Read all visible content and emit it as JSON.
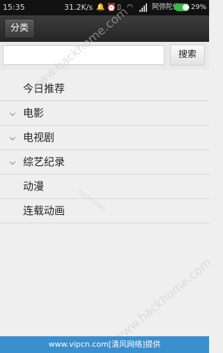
{
  "status_bar": {
    "time": "15:35",
    "net_speed": "31.2K/s",
    "carrier": "阿弥陀佛",
    "battery": "29%",
    "icons": [
      "bell-icon",
      "alarm-icon",
      "vibrate-icon",
      "wifi-icon",
      "signal-icon",
      "toggle-icon"
    ]
  },
  "toolbar": {
    "category_label": "分类"
  },
  "search": {
    "value": "",
    "button_label": "搜索"
  },
  "menu": {
    "items": [
      {
        "label": "今日推荐",
        "expandable": false
      },
      {
        "label": "电影",
        "expandable": true
      },
      {
        "label": "电视剧",
        "expandable": true
      },
      {
        "label": "综艺纪录",
        "expandable": true
      },
      {
        "label": "动漫",
        "expandable": false
      },
      {
        "label": "连载动画",
        "expandable": false
      }
    ]
  },
  "watermark": {
    "text_1": "www.hackhome.com",
    "text_2": "www.hackhome.com",
    "text_3": "hackhome"
  },
  "footer": {
    "text": "www.vipcn.com[清风网络]提供"
  }
}
